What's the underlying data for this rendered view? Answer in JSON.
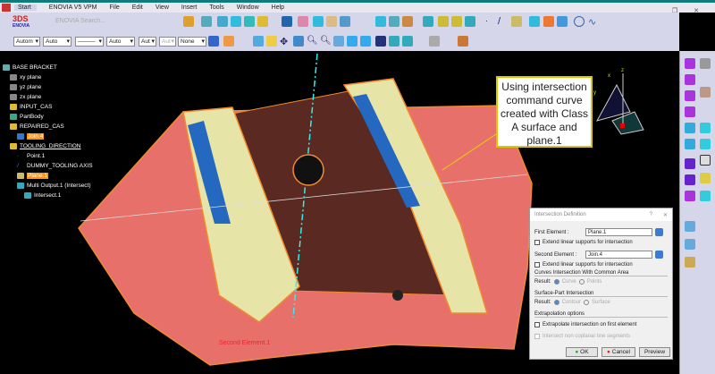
{
  "menu": {
    "items": [
      "Start",
      "ENOVIA V5 VPM",
      "File",
      "Edit",
      "View",
      "Insert",
      "Tools",
      "Window",
      "Help"
    ]
  },
  "toolbar": {
    "enovia_search": "ENOVIA Search...",
    "color_select": "Autom",
    "transparency_select": "Auto",
    "linetype_select": "———",
    "thickness_select": "Auto",
    "layer_a": "Aut",
    "layer_b": "Aut",
    "layer_select": "None",
    "logo_text": "ENOVIA"
  },
  "tree": {
    "root": "BASE BRACKET",
    "items": [
      "xy plane",
      "yz plane",
      "zx plane",
      "INPUT_CAS",
      "PartBody",
      "REPAIRED_CAS",
      "Join.4",
      "TOOLING_DIRECTION",
      "Point.1",
      "DUMMY_TOOLING AXIS",
      "Plane.1",
      "Multi Output.1 (Intersect)",
      "Intersect.1"
    ]
  },
  "callout": {
    "text": "Using intersection command curve created with Class A surface and plane.1"
  },
  "viewport": {
    "second_element_label": "Second Element.1",
    "axis": {
      "x": "x",
      "y": "y",
      "z": "z"
    }
  },
  "dialog": {
    "title": "Intersection Definition",
    "help": "?",
    "close": "✕",
    "first_label": "First Element :",
    "first_value": "Plane.1",
    "extend1": "Extend linear supports for intersection",
    "second_label": "Second Element :",
    "second_value": "Join.4",
    "extend2": "Extend linear supports for intersection",
    "curves_group": "Curves Intersection With Common Area",
    "result_label": "Result:",
    "curve": "Curve",
    "points": "Points",
    "surface_group": "Surface-Part Intersection",
    "contour": "Contour",
    "surface": "Surface",
    "extrap_group": "Extrapolation options",
    "extrap": "Extrapolate intersection on first element",
    "noncoplanar": "Intersect non coplanar line segments",
    "ok": "OK",
    "cancel": "Cancel",
    "preview": "Preview"
  },
  "colors": {
    "accent": "#f7931e",
    "surface": "#e8706a",
    "rib": "#e8e4a8",
    "panel": "#5a2a22"
  }
}
